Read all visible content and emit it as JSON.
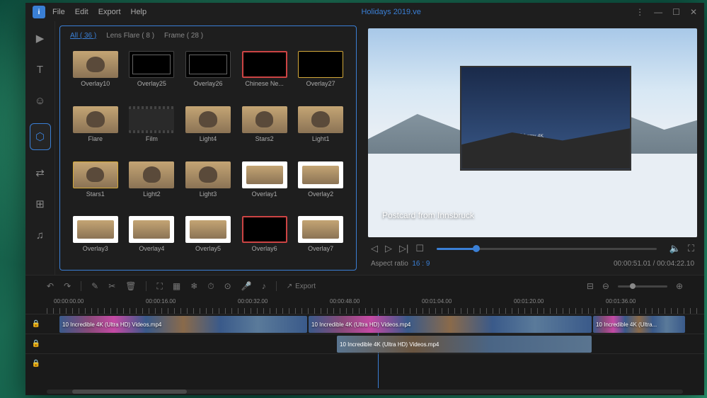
{
  "titlebar": {
    "app_initial": "i",
    "menu": [
      "File",
      "Edit",
      "Export",
      "Help"
    ],
    "title": "Holidays 2019.ve"
  },
  "media": {
    "tabs": [
      {
        "label": "All ( 36 )",
        "active": true
      },
      {
        "label": "Lens Flare ( 8 )",
        "active": false
      },
      {
        "label": "Frame ( 28 )",
        "active": false
      }
    ],
    "items": [
      {
        "label": "Overlay10",
        "style": "dog"
      },
      {
        "label": "Overlay25",
        "style": "frame-black"
      },
      {
        "label": "Overlay26",
        "style": "frame-black"
      },
      {
        "label": "Chinese Ne...",
        "style": "frame-red"
      },
      {
        "label": "Overlay27",
        "style": "frame-gold"
      },
      {
        "label": "Flare",
        "style": "dog"
      },
      {
        "label": "Film",
        "style": "film"
      },
      {
        "label": "Light4",
        "style": "dog"
      },
      {
        "label": "Stars2",
        "style": "dog"
      },
      {
        "label": "Light1",
        "style": "dog"
      },
      {
        "label": "Stars1",
        "style": "dog",
        "selected": true
      },
      {
        "label": "Light2",
        "style": "dog"
      },
      {
        "label": "Light3",
        "style": "dog"
      },
      {
        "label": "Overlay1",
        "style": "whiteframe"
      },
      {
        "label": "Overlay2",
        "style": "whiteframe"
      },
      {
        "label": "Overlay3",
        "style": "whiteframe"
      },
      {
        "label": "Overlay4",
        "style": "whiteframe"
      },
      {
        "label": "Overlay5",
        "style": "whiteframe"
      },
      {
        "label": "Overlay6",
        "style": "frame-red"
      },
      {
        "label": "Overlay7",
        "style": "whiteframe"
      }
    ]
  },
  "preview": {
    "caption": "Postcard from Innsbruck",
    "overlay_label": "Alchemy 4K",
    "aspect_label": "Aspect ratio",
    "aspect_value": "16 : 9",
    "current_time": "00:00:51.01",
    "total_time": "00:04:22.10"
  },
  "toolbar": {
    "export_label": "Export"
  },
  "timeline": {
    "ruler": [
      "00:00:00.00",
      "00:00:16.00",
      "00:00:32.00",
      "00:00:48.00",
      "00:01:04.00",
      "00:01:20.00",
      "00:01:36.00"
    ],
    "clip1_label": "10 Incredible 4K (Ultra HD) Videos.mp4",
    "clip1b_label": "10 Incredible 4K (Ultra HD) Videos.mp4",
    "clip1c_label": "10 Incredible 4K (Ultra...",
    "clip2_label": "10 Incredible 4K (Ultra HD) Videos.mp4"
  }
}
